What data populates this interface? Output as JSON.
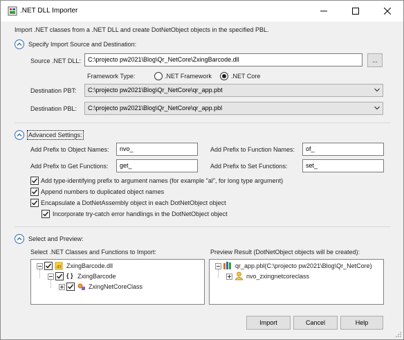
{
  "window": {
    "title": ".NET DLL Importer"
  },
  "description": "Import .NET classes from a .NET DLL and create DotNetObject objects in the specified PBL.",
  "section_source": {
    "title": "Specify Import Source and Destination:",
    "source_dll_label": "Source .NET DLL:",
    "source_dll_value": "C:\\projecto pw2021\\Blog\\Qr_NetCore\\ZxingBarcode.dll",
    "browse_label": "...",
    "framework_label": "Framework Type:",
    "framework_options": [
      ".NET Framework",
      ".NET Core"
    ],
    "framework_selected": ".NET Core",
    "dest_pbt_label": "Destination PBT:",
    "dest_pbt_value": "C:\\projecto pw2021\\Blog\\Qr_NetCore\\qr_app.pbt",
    "dest_pbl_label": "Destination PBL:",
    "dest_pbl_value": "C:\\projecto pw2021\\Blog\\Qr_NetCore\\qr_app.pbl"
  },
  "section_advanced": {
    "title": "Advanced Settings:",
    "prefix_object_label": "Add Prefix to Object Names:",
    "prefix_object_value": "nvo_",
    "prefix_function_label": "Add Prefix to Function Names:",
    "prefix_function_value": "of_",
    "prefix_get_label": "Add Prefix to Get Functions:",
    "prefix_get_value": "get_",
    "prefix_set_label": "Add Prefix to Set Functions:",
    "prefix_set_value": "set_",
    "check_type_prefix": "Add type-identifying prefix to argument names (for example \"al\", for long type argument)",
    "check_append_numbers": "Append numbers to duplicated object names",
    "check_encapsulate": "Encapsulate a DotNetAssembly object in each DotNetObject object",
    "check_try_catch": "Incorporate try-catch error handlings in the DotNetObject object"
  },
  "section_preview": {
    "title": "Select and Preview:",
    "left_label": "Select .NET Classes and Functions to Import:",
    "right_label": "Preview Result (DotNetObject objects will be created):",
    "left_tree": [
      "ZxingBarcode.dll",
      "ZxingBarcode",
      "ZxingNetCoreClass"
    ],
    "right_tree": [
      "qr_app.pbl(C:\\projecto pw2021\\Blog\\Qr_NetCore)",
      "nvo_zxingnetcoreclass"
    ]
  },
  "buttons": {
    "import": "Import",
    "cancel": "Cancel",
    "help": "Help"
  },
  "colors": {
    "accent": "#2b6cb0",
    "window_bg": "#f0f0f0",
    "check": "#1e1e1e"
  }
}
